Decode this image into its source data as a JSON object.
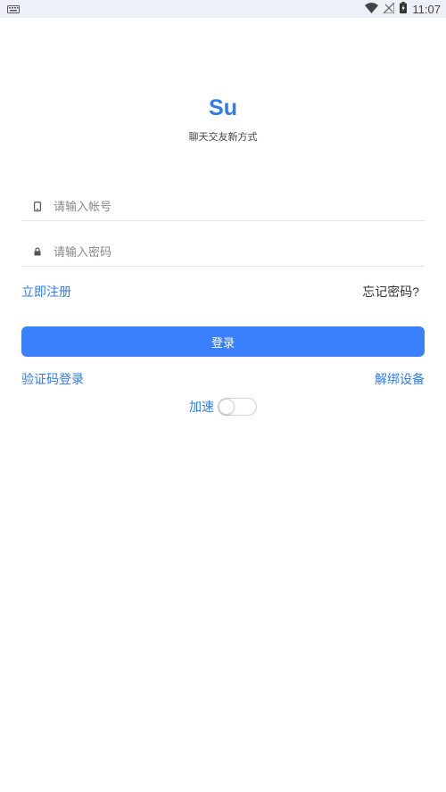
{
  "status_bar": {
    "time": "11:07",
    "icons": [
      "keyboard-icon",
      "wifi-icon",
      "no-signal-icon",
      "battery-charging-icon"
    ]
  },
  "app": {
    "logo_text": "Su",
    "slogan": "聊天交友新方式"
  },
  "form": {
    "account_placeholder": "请输入帐号",
    "password_placeholder": "请输入密码",
    "account_icon": "phone-icon",
    "password_icon": "lock-icon"
  },
  "links": {
    "register": "立即注册",
    "forgot_password": "忘记密码?",
    "sms_login": "验证码登录",
    "unbind_device": "解绑设备"
  },
  "login_button": "登录",
  "accelerate": {
    "label": "加速",
    "enabled": false
  },
  "colors": {
    "accent": "#2f7bf0",
    "button": "#3a80fb",
    "status_bar_bg": "#eef0f7"
  }
}
